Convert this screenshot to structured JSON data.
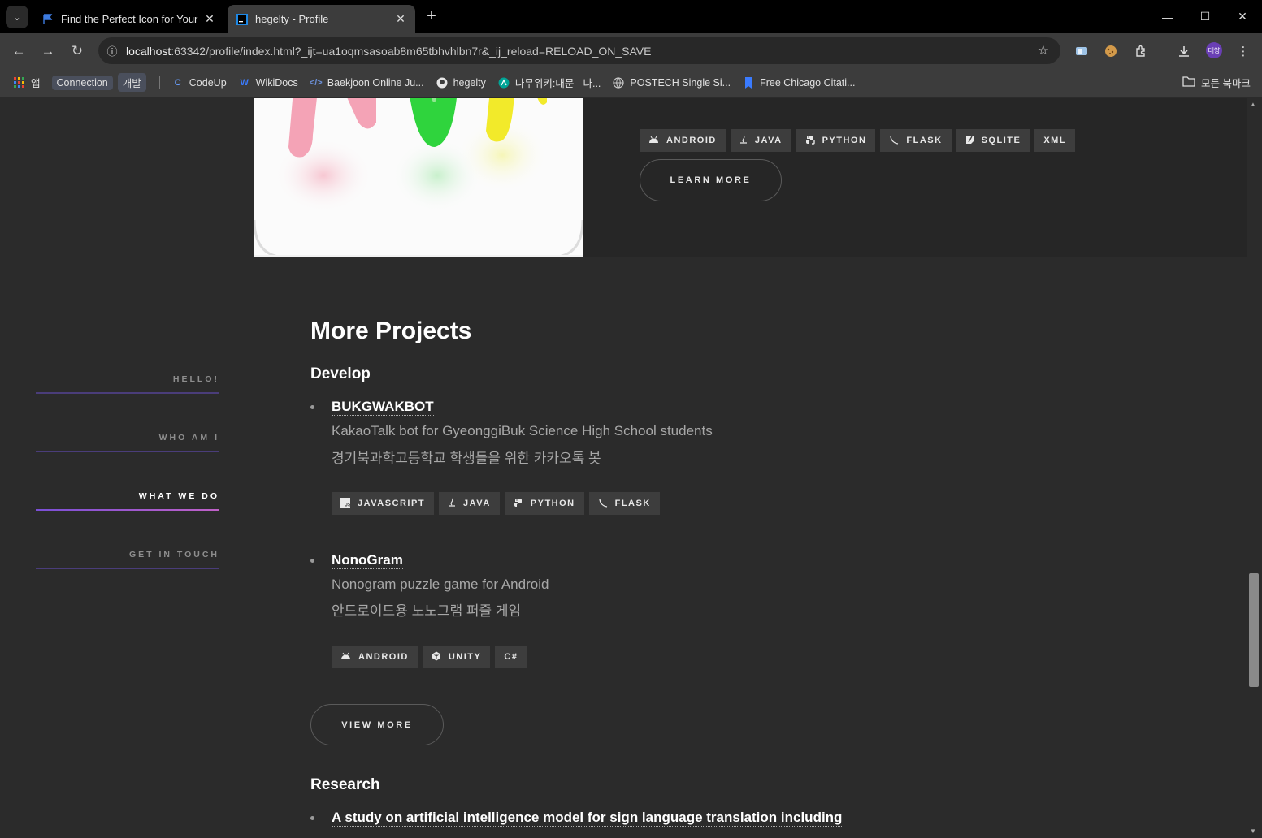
{
  "browser": {
    "tabs": [
      {
        "title": "Find the Perfect Icon for Your",
        "active": false
      },
      {
        "title": "hegelty - Profile",
        "active": true
      }
    ],
    "url_host": "localhost",
    "url_rest": ":63342/profile/index.html?_ijt=ua1oqmsasoab8m65tbhvhlbn7r&_ij_reload=RELOAD_ON_SAVE",
    "avatar_label": "태양",
    "bookmarks": [
      {
        "label": "앱",
        "icon": "apps-grid-icon"
      },
      {
        "label": "Connection",
        "icon": "none",
        "chip": true
      },
      {
        "label": "개발",
        "icon": "none",
        "chip": true
      },
      {
        "label": "CodeUp",
        "icon": "codeup-icon"
      },
      {
        "label": "WikiDocs",
        "icon": "wikidocs-icon"
      },
      {
        "label": "Baekjoon Online Ju...",
        "icon": "code-icon"
      },
      {
        "label": "hegelty",
        "icon": "github-icon"
      },
      {
        "label": "나무위키:대문 - 나...",
        "icon": "namuwiki-icon"
      },
      {
        "label": "POSTECH Single Si...",
        "icon": "globe-icon"
      },
      {
        "label": "Free Chicago Citati...",
        "icon": "bookmark-icon"
      }
    ],
    "all_bookmarks": "모든 북마크"
  },
  "colors": {
    "accent_purple": "#7a4fd6",
    "accent_pink": "#c061c8",
    "background": "#2b2b2b"
  },
  "featured": {
    "tags": [
      {
        "label": "ANDROID",
        "icon": "android-icon"
      },
      {
        "label": "JAVA",
        "icon": "java-icon"
      },
      {
        "label": "PYTHON",
        "icon": "python-icon"
      },
      {
        "label": "FLASK",
        "icon": "flask-icon"
      },
      {
        "label": "SQLITE",
        "icon": "sqlite-icon"
      },
      {
        "label": "XML",
        "icon": "none"
      }
    ],
    "learn_more": "LEARN MORE"
  },
  "sidenav": [
    {
      "label": "HELLO!",
      "active": false
    },
    {
      "label": "WHO AM I",
      "active": false
    },
    {
      "label": "WHAT WE DO",
      "active": true
    },
    {
      "label": "GET IN TOUCH",
      "active": false
    }
  ],
  "more": {
    "title": "More Projects",
    "develop_heading": "Develop",
    "projects": [
      {
        "name": "BUKGWAKBOT",
        "desc_en": "KakaoTalk bot for GyeonggiBuk Science High School students",
        "desc_ko": "경기북과학고등학교 학생들을 위한 카카오톡 봇",
        "tags": [
          {
            "label": "JAVASCRIPT",
            "icon": "javascript-icon"
          },
          {
            "label": "JAVA",
            "icon": "java-icon"
          },
          {
            "label": "PYTHON",
            "icon": "python-icon"
          },
          {
            "label": "FLASK",
            "icon": "flask-icon"
          }
        ]
      },
      {
        "name": "NonoGram",
        "desc_en": "Nonogram puzzle game for Android",
        "desc_ko": "안드로이드용 노노그램 퍼즐 게임",
        "tags": [
          {
            "label": "ANDROID",
            "icon": "android-icon"
          },
          {
            "label": "UNITY",
            "icon": "unity-icon"
          },
          {
            "label": "C#",
            "icon": "none"
          }
        ]
      }
    ],
    "view_more": "VIEW MORE",
    "research_heading": "Research",
    "research_first": "A study on artificial intelligence model for sign language translation including"
  }
}
